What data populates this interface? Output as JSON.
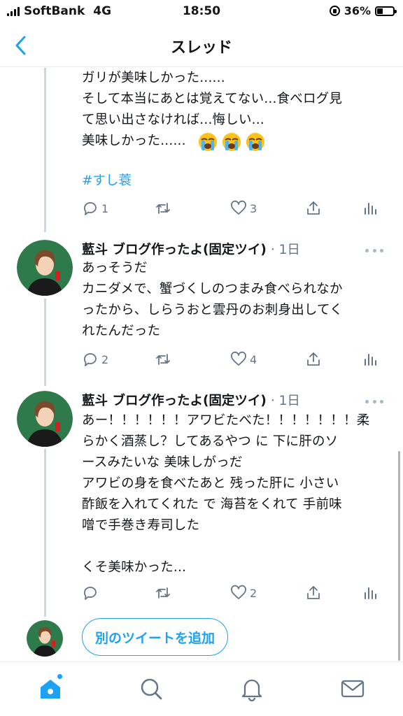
{
  "status_bar": {
    "carrier": "SoftBank",
    "network": "4G",
    "time": "18:50",
    "battery_percent": "36%"
  },
  "header": {
    "title": "スレッド"
  },
  "tweet_prev": {
    "text": "ガリが美味しかった......\nそして本当にあとは覚えてない...食べログ見\nて思い出さなければ...悔しい...\n美味しかった......",
    "emojis": [
      "loudly-crying-face",
      "loudly-crying-face",
      "loudly-crying-face"
    ],
    "hashtag": "#すし蓑",
    "replies": "1",
    "retweets": "",
    "likes": "3"
  },
  "tweet2": {
    "author": "藍斗 ブログ作ったよ(固定ツイ)",
    "time": "1日",
    "text": "あっそうだ\nカニダメで、蟹づくしのつまみ食べられなか\nったから、しらうおと雲丹のお刺身出してく\nれたんだった",
    "replies": "2",
    "retweets": "",
    "likes": "4"
  },
  "tweet3": {
    "author": "藍斗 ブログ作ったよ(固定ツイ)",
    "time": "1日",
    "text": "あー！！！！！！アワビたべた！！！！！！！柔\nらかく酒蒸し？してあるやつ に 下に肝のソ\nースみたいな 美味しがっだ\nアワビの身を食べたあと 残った肝に 小さい\n酢飯を入れてくれた で 海苔をくれて 手前味\n噌で手巻き寿司した\n\nくそ美味かった...",
    "replies": "",
    "retweets": "",
    "likes": "2"
  },
  "compose": {
    "add_button": "別のツイートを追加"
  },
  "colors": {
    "accent": "#1da1f2",
    "icon_gray": "#657786",
    "thread_line": "#ccd6dd"
  }
}
